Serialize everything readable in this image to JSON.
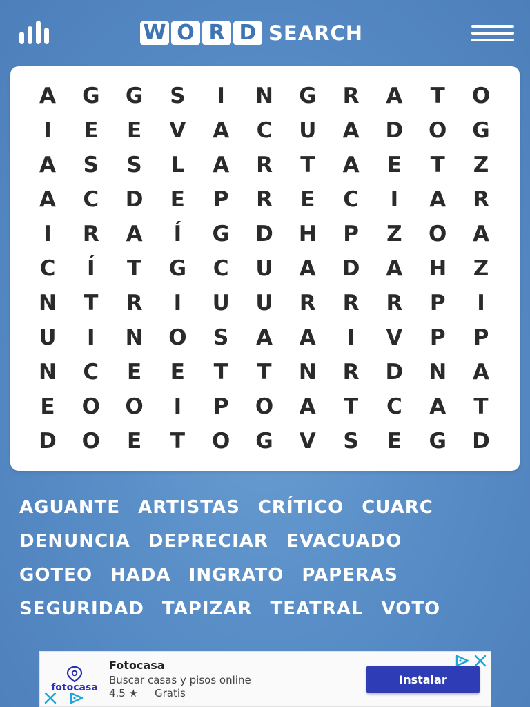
{
  "header": {
    "logo_tiles": [
      "W",
      "O",
      "R",
      "D"
    ],
    "logo_suffix": "SEARCH",
    "stats_icon": "bar-chart-icon",
    "menu_icon": "hamburger-menu-icon"
  },
  "grid": {
    "rows": [
      [
        "A",
        "G",
        "G",
        "S",
        "I",
        "N",
        "G",
        "R",
        "A",
        "T",
        "O"
      ],
      [
        "I",
        "E",
        "E",
        "V",
        "A",
        "C",
        "U",
        "A",
        "D",
        "O",
        "G"
      ],
      [
        "A",
        "S",
        "S",
        "L",
        "A",
        "R",
        "T",
        "A",
        "E",
        "T",
        "Z"
      ],
      [
        "A",
        "C",
        "D",
        "E",
        "P",
        "R",
        "E",
        "C",
        "I",
        "A",
        "R"
      ],
      [
        "I",
        "R",
        "A",
        "Í",
        "G",
        "D",
        "H",
        "P",
        "Z",
        "O",
        "A"
      ],
      [
        "C",
        "Í",
        "T",
        "G",
        "C",
        "U",
        "A",
        "D",
        "A",
        "H",
        "Z"
      ],
      [
        "N",
        "T",
        "R",
        "I",
        "U",
        "U",
        "R",
        "R",
        "R",
        "P",
        "I"
      ],
      [
        "U",
        "I",
        "N",
        "O",
        "S",
        "A",
        "A",
        "I",
        "V",
        "P",
        "P"
      ],
      [
        "N",
        "C",
        "E",
        "E",
        "T",
        "T",
        "N",
        "R",
        "D",
        "N",
        "A"
      ],
      [
        "E",
        "O",
        "O",
        "I",
        "P",
        "O",
        "A",
        "T",
        "C",
        "A",
        "T"
      ],
      [
        "D",
        "O",
        "E",
        "T",
        "O",
        "G",
        "V",
        "S",
        "E",
        "G",
        "D"
      ]
    ]
  },
  "words": [
    [
      "AGUANTE",
      "ARTISTAS",
      "CRÍTICO",
      "CUARC"
    ],
    [
      "DENUNCIA",
      "DEPRECIAR",
      "EVACUADO"
    ],
    [
      "GOTEO",
      "HADA",
      "INGRATO",
      "PAPERAS"
    ],
    [
      "SEGURIDAD",
      "TAPIZAR",
      "TEATRAL",
      "VOTO"
    ]
  ],
  "ad": {
    "app_name": "Fotocasa",
    "description": "Buscar casas y pisos online",
    "rating": "4.5 ★",
    "price": "Gratis",
    "install_label": "Instalar",
    "logo_text": "fotocasa",
    "colors": {
      "install_bg": "#2e3db5",
      "brand": "#2a2fb5",
      "adchoices": "#1aa6d8"
    }
  },
  "colors": {
    "background": "#5a8fc8",
    "logo_tile_text": "#3f74b3",
    "grid_letter": "#2a2a2a",
    "word_text": "#ffffff"
  }
}
